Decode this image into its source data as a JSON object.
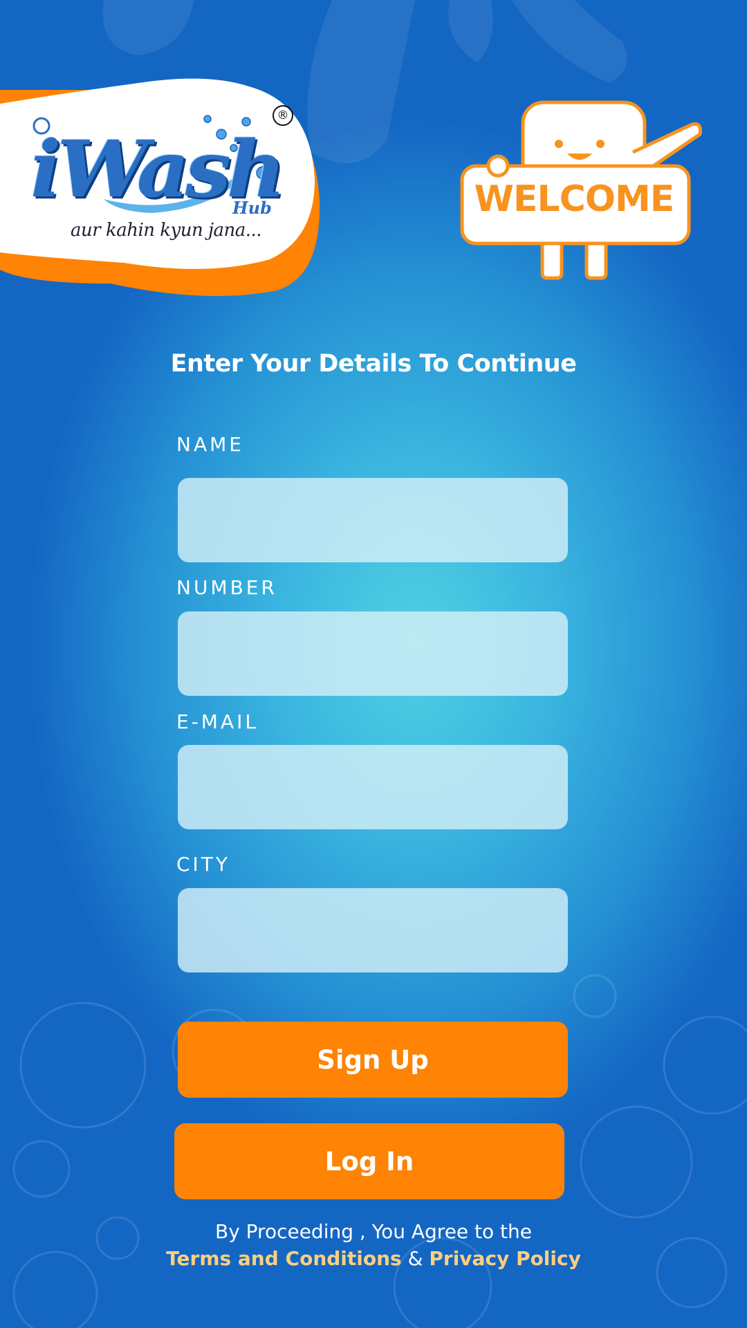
{
  "brand": {
    "logo_text": "iWash",
    "registered_mark": "®",
    "sub_label": "Hub",
    "tagline": "aur kahin kyun jana..."
  },
  "mascot": {
    "sign_text": "WELCOME"
  },
  "form": {
    "heading": "Enter Your Details To Continue",
    "fields": [
      {
        "label": "NAME",
        "value": "",
        "placeholder": ""
      },
      {
        "label": "NUMBER",
        "value": "",
        "placeholder": ""
      },
      {
        "label": "E-MAIL",
        "value": "",
        "placeholder": ""
      },
      {
        "label": "CITY",
        "value": "",
        "placeholder": ""
      }
    ],
    "signup_label": "Sign Up",
    "login_label": "Log In"
  },
  "footer": {
    "line1": "By Proceeding , You Agree to the",
    "terms_label": "Terms and Conditions",
    "ampersand": "&",
    "privacy_label": "Privacy Policy"
  },
  "colors": {
    "accent": "#ff8304",
    "link": "#ffcf7d",
    "background_center": "#4fd0e2",
    "background_edge": "#1466c3"
  }
}
